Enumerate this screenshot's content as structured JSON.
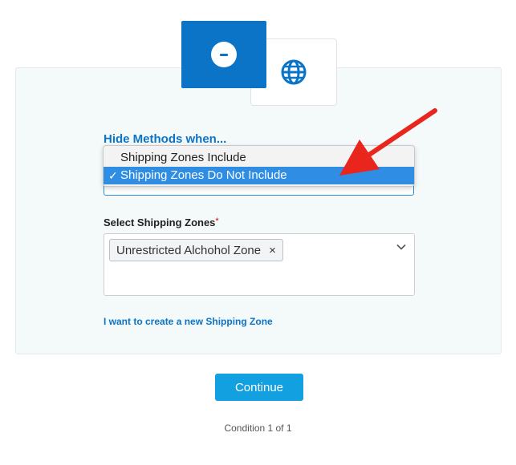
{
  "icons": {
    "minus": "minus-circle-icon",
    "globe": "globe-icon",
    "chevron": "chevron-down-icon",
    "remove": "close-icon"
  },
  "colors": {
    "accent": "#0b74c7",
    "button": "#12a0e0",
    "selected_option": "#2f8de4",
    "annotation_arrow": "#e8261e"
  },
  "hide_methods": {
    "label": "Hide Methods when...",
    "options": [
      {
        "label": "Shipping Zones Include",
        "selected": false
      },
      {
        "label": "Shipping Zones Do Not Include",
        "selected": true
      }
    ],
    "check_mark": "✓"
  },
  "shipping_zones": {
    "label": "Select Shipping Zones",
    "required_mark": "*",
    "selected_chips": [
      {
        "label": "Unrestricted Alchohol Zone",
        "remove": "×"
      }
    ]
  },
  "create_zone_link": "I want to create a new Shipping Zone",
  "continue_label": "Continue",
  "condition_text": "Condition 1 of 1"
}
